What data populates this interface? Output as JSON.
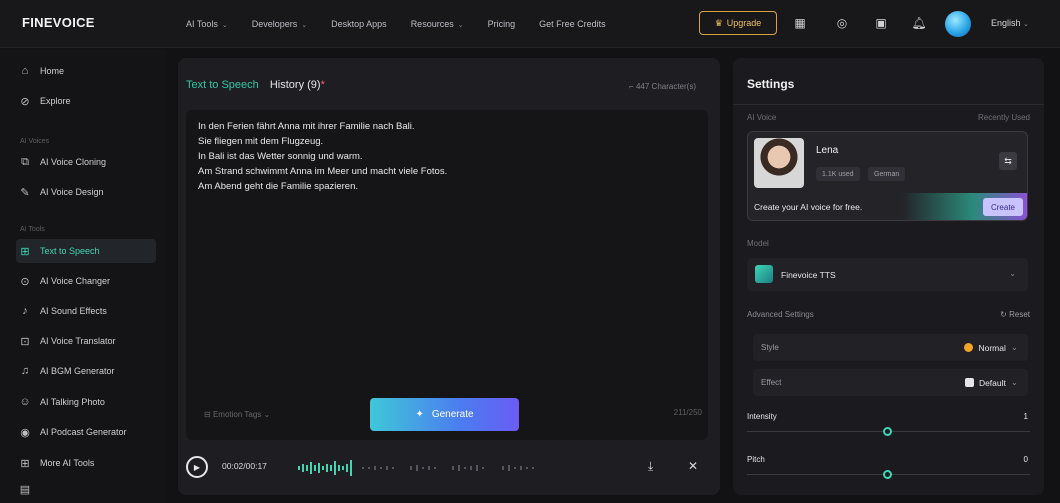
{
  "topbar": {
    "logo": "FINEVOICE",
    "nav": [
      "AI Tools",
      "Developers",
      "Desktop Apps",
      "Resources",
      "Pricing",
      "Get Free Credits"
    ],
    "upgrade": "Upgrade",
    "language": "English"
  },
  "sidebar": {
    "home": "Home",
    "explore": "Explore",
    "group1": "AI Voices",
    "cloning": "AI Voice Cloning",
    "design": "AI Voice Design",
    "group2": "AI Tools",
    "tts": "Text to Speech",
    "changer": "AI Voice Changer",
    "sfx": "AI Sound Effects",
    "translator": "AI Voice Translator",
    "bgm": "AI BGM Generator",
    "talking": "AI Talking Photo",
    "podcast": "AI Podcast Generator",
    "more": "More AI Tools"
  },
  "editor": {
    "tab_active": "Text to Speech",
    "tab_history": "History (9)",
    "history_dot": "*",
    "chars": "447 Character(s)",
    "lines": [
      "In den Ferien fährt Anna mit ihrer Familie nach Bali.",
      "Sie fliegen mit dem Flugzeug.",
      "In Bali ist das Wetter sonnig und warm.",
      "Am Strand schwimmt Anna im Meer und macht viele Fotos.",
      "Am Abend geht die Familie spazieren."
    ],
    "emotion_tags": "Emotion Tags",
    "generate": "Generate",
    "count": "211/250",
    "time": "00:02/00:17"
  },
  "settings": {
    "title": "Settings",
    "ai_voice": "AI Voice",
    "recently_used": "Recently Used",
    "voice_name": "Lena",
    "tag1": "1.1K used",
    "tag2": "German",
    "promo": "Create your AI voice for free.",
    "create": "Create",
    "model_label": "Model",
    "model_name": "Finevoice TTS",
    "advanced": "Advanced Settings",
    "reset": "Reset",
    "style_label": "Style",
    "style_value": "Normal",
    "effect_label": "Effect",
    "effect_value": "Default",
    "intensity_label": "Intensity",
    "intensity_value": "1",
    "pitch_label": "Pitch",
    "pitch_value": "0"
  },
  "colors": {
    "accent": "#3fd6b4",
    "generate_start": "#3fc7d8",
    "generate_end": "#6a5cf5",
    "upgrade": "#f0c15a"
  }
}
